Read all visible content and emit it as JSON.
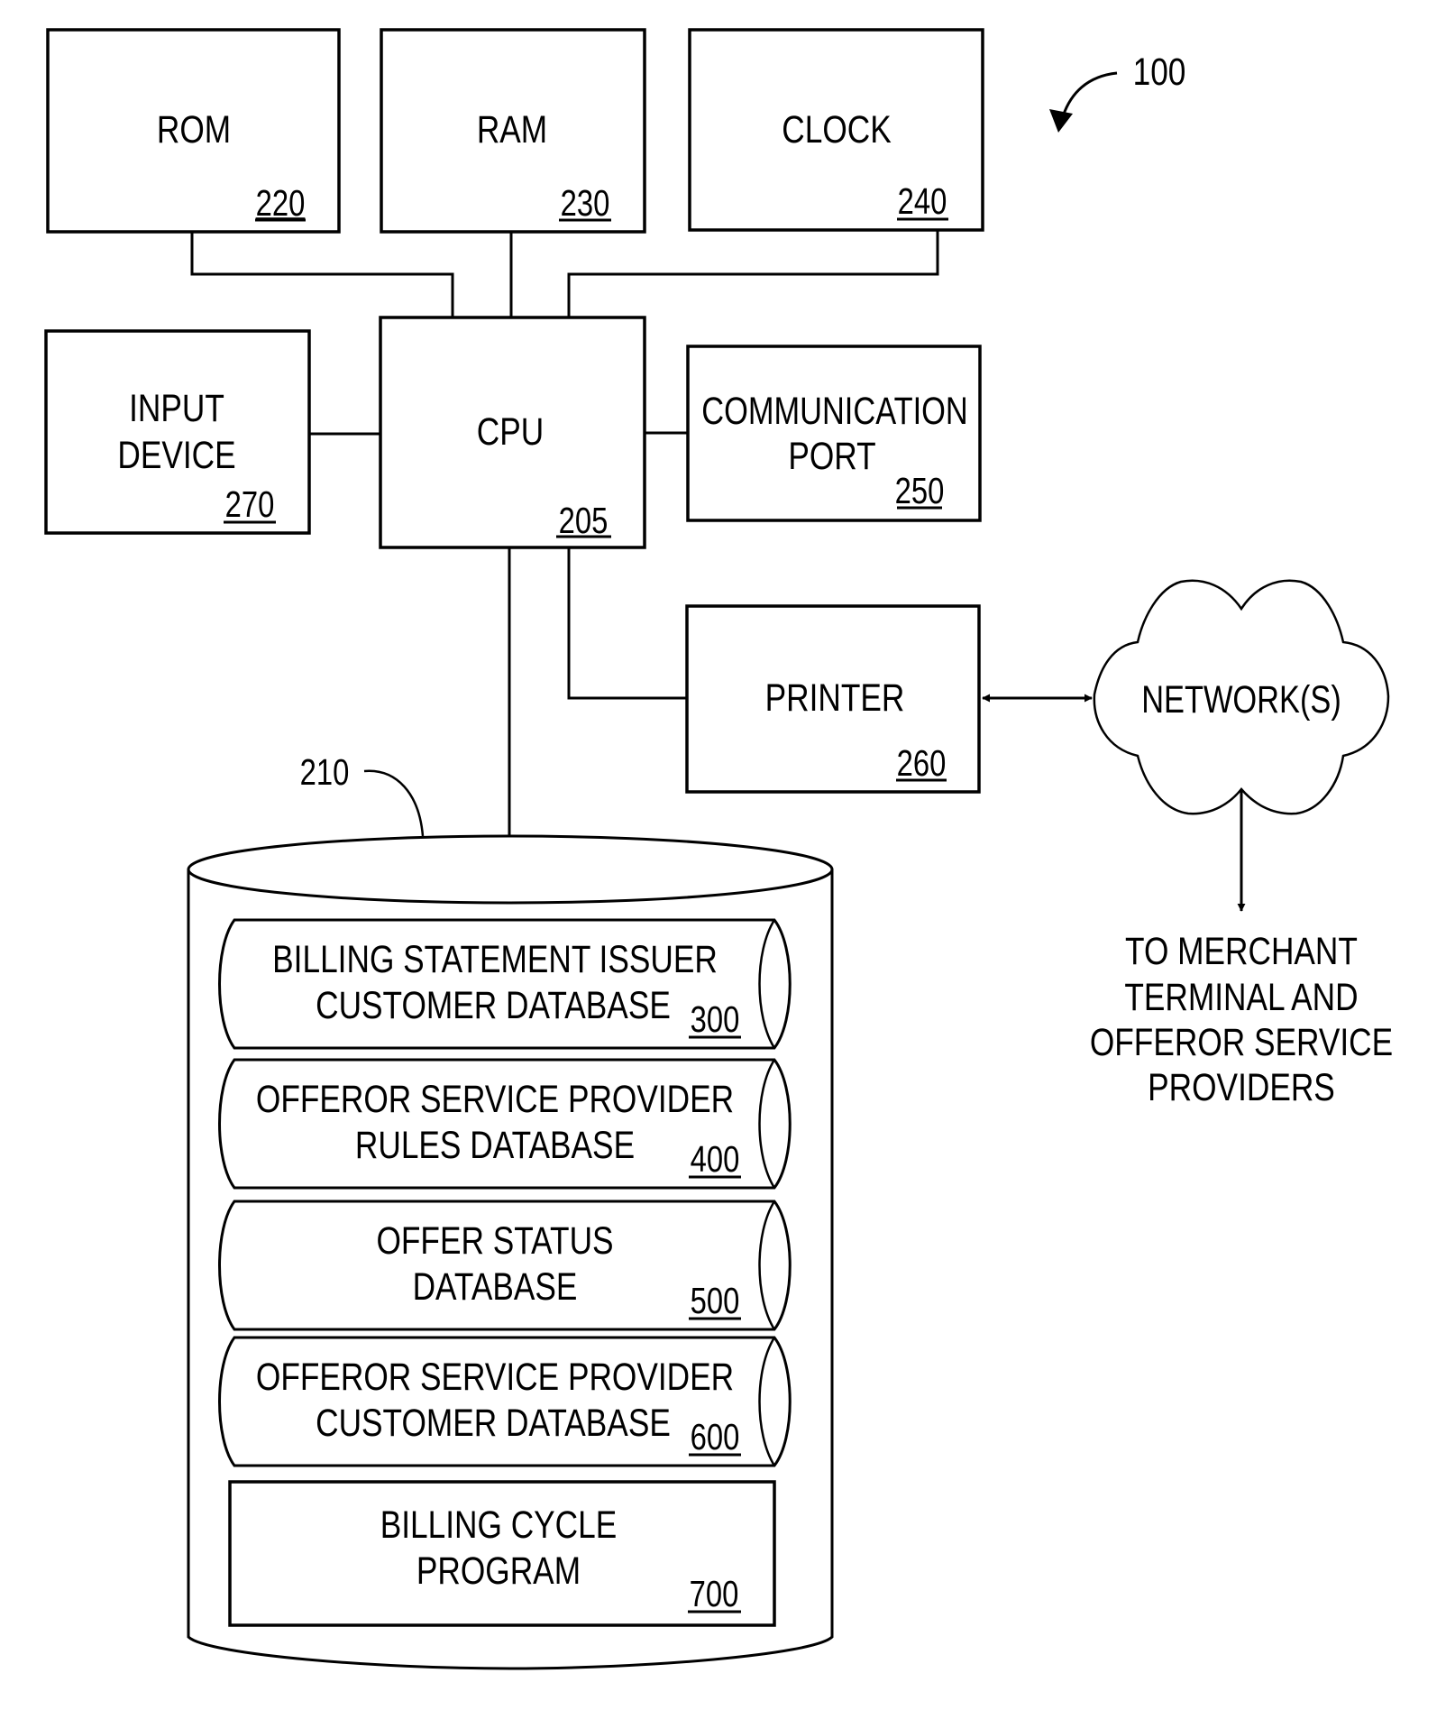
{
  "figure": {
    "reference_number": "100",
    "colors": {
      "stroke": "#000000",
      "background": "#ffffff"
    }
  },
  "components": {
    "rom": {
      "label": "ROM",
      "ref": "220"
    },
    "ram": {
      "label": "RAM",
      "ref": "230"
    },
    "clock": {
      "label": "CLOCK",
      "ref": "240"
    },
    "input_device": {
      "label_lines": [
        "INPUT",
        "DEVICE"
      ],
      "ref": "270"
    },
    "cpu": {
      "label": "CPU",
      "ref": "205"
    },
    "communication_port": {
      "label_lines": [
        "COMMUNICATION",
        "PORT"
      ],
      "ref": "250"
    },
    "printer": {
      "label": "PRINTER",
      "ref": "260"
    },
    "network": {
      "label": "NETWORK(S)"
    },
    "destination": {
      "label_lines": [
        "TO MERCHANT",
        "TERMINAL AND",
        "OFFEROR SERVICE",
        "PROVIDERS"
      ]
    }
  },
  "storage": {
    "ref": "210",
    "databases": [
      {
        "label_lines": [
          "BILLING STATEMENT ISSUER",
          "CUSTOMER DATABASE"
        ],
        "ref": "300"
      },
      {
        "label_lines": [
          "OFFEROR SERVICE PROVIDER",
          "RULES DATABASE"
        ],
        "ref": "400"
      },
      {
        "label_lines": [
          "OFFER STATUS",
          "DATABASE"
        ],
        "ref": "500"
      },
      {
        "label_lines": [
          "OFFEROR SERVICE PROVIDER",
          "CUSTOMER DATABASE"
        ],
        "ref": "600"
      }
    ],
    "program": {
      "label_lines": [
        "BILLING CYCLE",
        "PROGRAM"
      ],
      "ref": "700"
    }
  }
}
